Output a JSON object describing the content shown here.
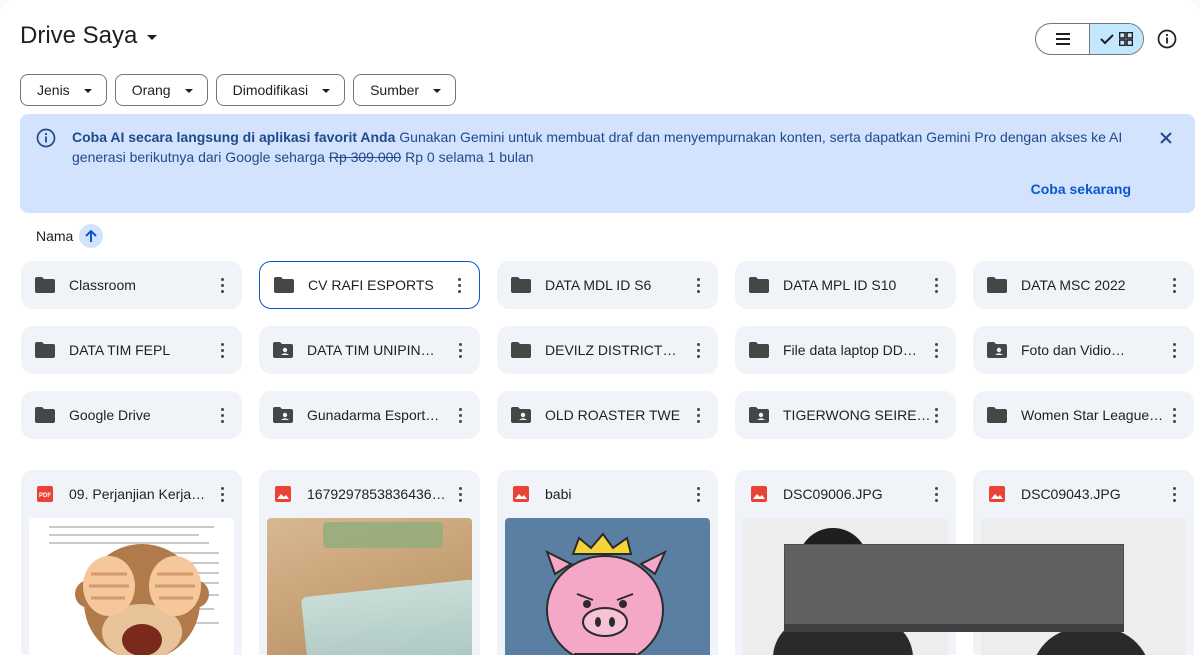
{
  "header": {
    "title": "Drive Saya"
  },
  "filters": [
    {
      "label": "Jenis"
    },
    {
      "label": "Orang"
    },
    {
      "label": "Dimodifikasi"
    },
    {
      "label": "Sumber"
    }
  ],
  "banner": {
    "heading": "Coba AI secara langsung di aplikasi favorit Anda",
    "body_1": "Gunakan Gemini untuk membuat draf dan menyempurnakan konten, serta dapatkan Gemini Pro dengan akses ke AI generasi berikutnya dari Google seharga",
    "old_price": "Rp 309.000",
    "body_2": "Rp 0 selama 1 bulan",
    "cta": "Coba sekarang"
  },
  "sort": {
    "label": "Nama"
  },
  "folders": [
    {
      "name": "Classroom",
      "shared": false
    },
    {
      "name": "CV RAFI ESPORTS",
      "shared": false,
      "selected": true
    },
    {
      "name": "DATA MDL ID S6",
      "shared": false
    },
    {
      "name": "DATA MPL ID S10",
      "shared": false
    },
    {
      "name": "DATA MSC 2022",
      "shared": false
    },
    {
      "name": "DATA TIM FEPL",
      "shared": false
    },
    {
      "name": "DATA TIM UNIPIN…",
      "shared": true
    },
    {
      "name": "DEVILZ DISTRICT…",
      "shared": false
    },
    {
      "name": "File data laptop DD…",
      "shared": false
    },
    {
      "name": "Foto dan Vidio…",
      "shared": true
    },
    {
      "name": "Google Drive",
      "shared": false
    },
    {
      "name": "Gunadarma Esport…",
      "shared": true
    },
    {
      "name": "OLD ROASTER TWE",
      "shared": true
    },
    {
      "name": "TIGERWONG SEIRE…",
      "shared": true
    },
    {
      "name": "Women Star League…",
      "shared": false
    }
  ],
  "files": [
    {
      "name": "09. Perjanjian Kerja…",
      "type": "pdf"
    },
    {
      "name": "1679297853836436…",
      "type": "image"
    },
    {
      "name": "babi",
      "type": "image"
    },
    {
      "name": "DSC09006.JPG",
      "type": "image"
    },
    {
      "name": "DSC09043.JPG",
      "type": "image"
    }
  ],
  "colors": {
    "accent": "#0b57d0",
    "banner_bg": "#d3e3fd",
    "pdf_red": "#ea4335",
    "folder_icon": "#444746"
  }
}
